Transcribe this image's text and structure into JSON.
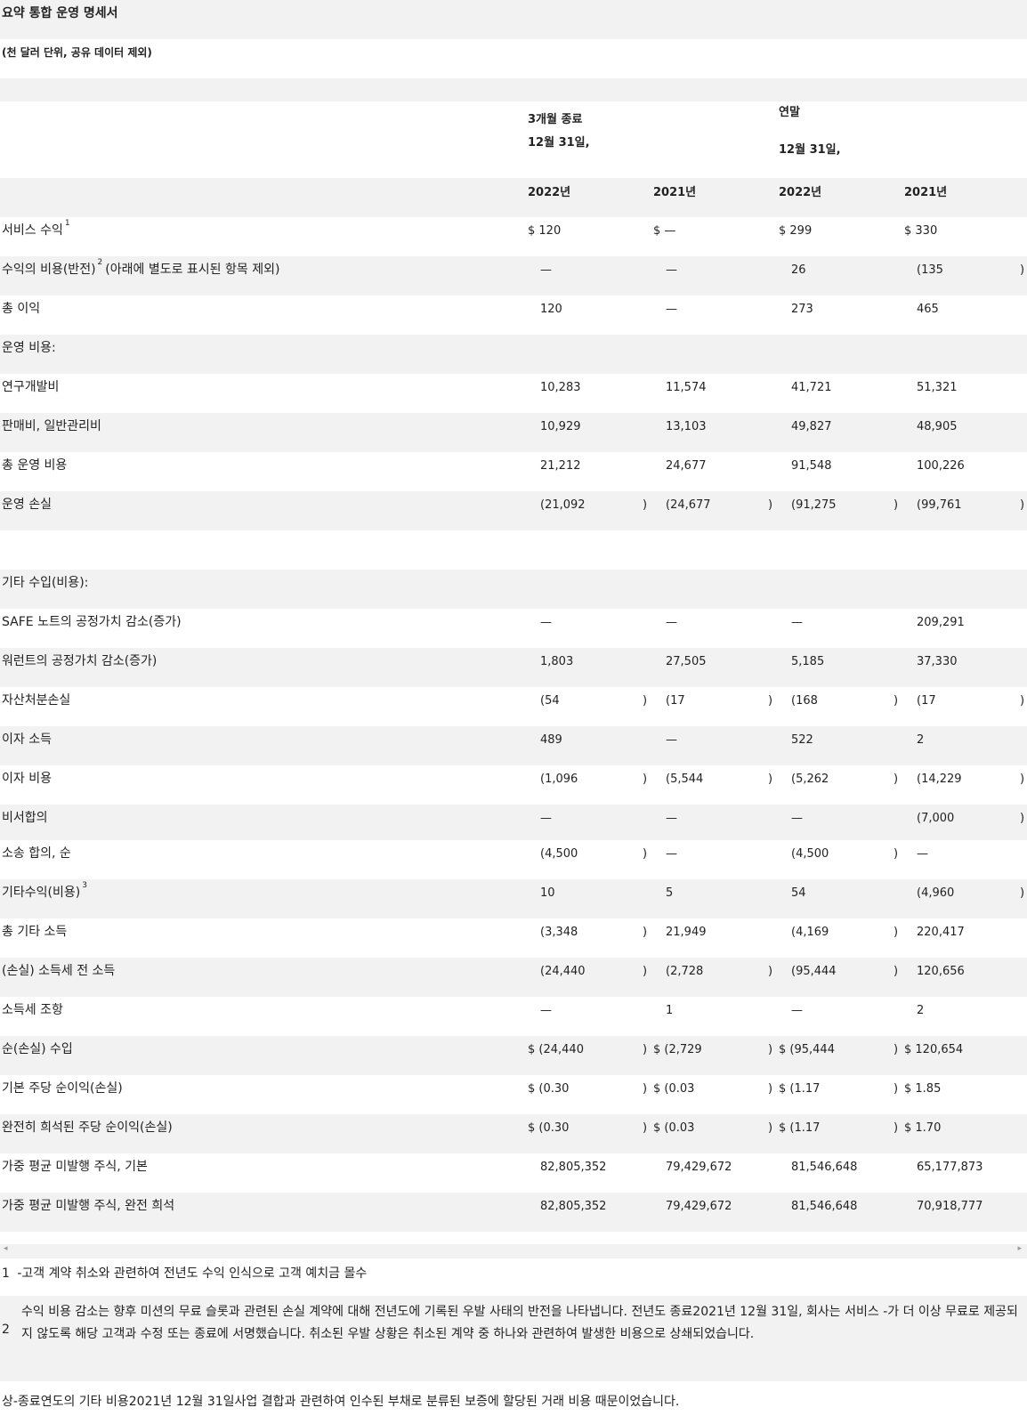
{
  "title": "요약 통합 운영 명세서",
  "subtitle": "(천 달러 단위, 공유 데이터 제외)",
  "header": {
    "three_months_line1": "3개월 종료",
    "three_months_line2": "12월 31일,",
    "year_end_line1": "연말",
    "year_end_line2": "12월 31일,",
    "years": [
      "2022년",
      "2021년",
      "2022년",
      "2021년"
    ]
  },
  "rows": [
    {
      "label": "서비스 수익",
      "sup": "1",
      "values": [
        "$ 120",
        "$ —",
        "$ 299",
        "$ 330"
      ],
      "parens": [
        false,
        false,
        false,
        false
      ]
    },
    {
      "label": "수익의 비용(반전)",
      "sup": "2",
      "label_suffix": "(아래에 별도로 표시된 항목 제외)",
      "values": [
        "—",
        "—",
        "26",
        "(135"
      ],
      "parens": [
        false,
        false,
        false,
        true
      ]
    },
    {
      "label": "총 이익",
      "values": [
        "120",
        "—",
        "273",
        "465"
      ],
      "parens": [
        false,
        false,
        false,
        false
      ]
    },
    {
      "label": "운영 비용:",
      "values": [
        "",
        "",
        "",
        ""
      ],
      "parens": [
        false,
        false,
        false,
        false
      ]
    },
    {
      "label": "연구개발비",
      "values": [
        "10,283",
        "11,574",
        "41,721",
        "51,321"
      ],
      "parens": [
        false,
        false,
        false,
        false
      ]
    },
    {
      "label": "판매비, 일반관리비",
      "values": [
        "10,929",
        "13,103",
        "49,827",
        "48,905"
      ],
      "parens": [
        false,
        false,
        false,
        false
      ]
    },
    {
      "label": "총 운영 비용",
      "values": [
        "21,212",
        "24,677",
        "91,548",
        "100,226"
      ],
      "parens": [
        false,
        false,
        false,
        false
      ]
    },
    {
      "label": "운영 손실",
      "values": [
        "(21,092",
        "(24,677",
        "(91,275",
        "(99,761"
      ],
      "parens": [
        true,
        true,
        true,
        true
      ]
    },
    {
      "label": "",
      "values": [
        "",
        "",
        "",
        ""
      ],
      "parens": [
        false,
        false,
        false,
        false
      ]
    },
    {
      "label": "기타 수입(비용):",
      "values": [
        "",
        "",
        "",
        ""
      ],
      "parens": [
        false,
        false,
        false,
        false
      ]
    },
    {
      "label": "SAFE 노트의 공정가치 감소(증가)",
      "values": [
        "—",
        "—",
        "—",
        "209,291"
      ],
      "parens": [
        false,
        false,
        false,
        false
      ]
    },
    {
      "label": "워런트의 공정가치 감소(증가)",
      "values": [
        "1,803",
        "27,505",
        "5,185",
        "37,330"
      ],
      "parens": [
        false,
        false,
        false,
        false
      ]
    },
    {
      "label": "자산처분손실",
      "values": [
        "(54",
        "(17",
        "(168",
        "(17"
      ],
      "parens": [
        true,
        true,
        true,
        true
      ]
    },
    {
      "label": "이자 소득",
      "values": [
        "489",
        "—",
        "522",
        "2"
      ],
      "parens": [
        false,
        false,
        false,
        false
      ]
    },
    {
      "label": "이자 비용",
      "values": [
        "(1,096",
        "(5,544",
        "(5,262",
        "(14,229"
      ],
      "parens": [
        true,
        true,
        true,
        true
      ]
    },
    {
      "label": "비서합의",
      "values": [
        "—",
        "—",
        "—",
        "(7,000"
      ],
      "parens": [
        false,
        false,
        false,
        true
      ],
      "short": true
    },
    {
      "label": "소송 합의, 순",
      "values": [
        "(4,500",
        "—",
        "(4,500",
        "—"
      ],
      "parens": [
        true,
        false,
        true,
        false
      ]
    },
    {
      "label": "기타수익(비용)",
      "sup": "3",
      "values": [
        "10",
        "5",
        "54",
        "(4,960"
      ],
      "parens": [
        false,
        false,
        false,
        true
      ]
    },
    {
      "label": "총 기타 소득",
      "values": [
        "(3,348",
        "21,949",
        "(4,169",
        "220,417"
      ],
      "parens": [
        true,
        false,
        true,
        false
      ]
    },
    {
      "label": "(손실) 소득세 전 소득",
      "values": [
        "(24,440",
        "(2,728",
        "(95,444",
        "120,656"
      ],
      "parens": [
        true,
        true,
        true,
        false
      ]
    },
    {
      "label": "소득세 조항",
      "values": [
        "—",
        "1",
        "—",
        "2"
      ],
      "parens": [
        false,
        false,
        false,
        false
      ]
    },
    {
      "label": "순(손실) 수입",
      "values": [
        "$ (24,440",
        "$ (2,729",
        "$ (95,444",
        "$ 120,654"
      ],
      "parens": [
        true,
        true,
        true,
        false
      ],
      "dollar": true
    },
    {
      "label": "기본 주당 순이익(손실)",
      "values": [
        "$ (0.30",
        "$ (0.03",
        "$ (1.17",
        "$ 1.85"
      ],
      "parens": [
        true,
        true,
        true,
        false
      ],
      "dollar": true
    },
    {
      "label": "완전히 희석된 주당 순이익(손실)",
      "values": [
        "$ (0.30",
        "$ (0.03",
        "$ (1.17",
        "$ 1.70"
      ],
      "parens": [
        true,
        true,
        true,
        false
      ],
      "dollar": true
    },
    {
      "label": "가중 평균 미발행 주식, 기본",
      "values": [
        "82,805,352",
        "79,429,672",
        "81,546,648",
        "65,177,873"
      ],
      "parens": [
        false,
        false,
        false,
        false
      ]
    },
    {
      "label": "가중 평균 미발행 주식, 완전 희석",
      "values": [
        "82,805,352",
        "79,429,672",
        "81,546,648",
        "70,918,777"
      ],
      "parens": [
        false,
        false,
        false,
        false
      ]
    }
  ],
  "scroll": {
    "left_arrow": "◂",
    "right_arrow": "▸"
  },
  "footnotes": {
    "fn1_num": "1",
    "fn1_text": "-고객 계약 취소와 관련하여 전년도 수익 인식으로 고객 예치금 몰수",
    "fn2_num": "2",
    "fn2_text": "수익 비용 감소는 향후 미션의 무료 슬롯과 관련된 손실 계약에 대해 전년도에 기록된 우발 사태의 반전을 나타냅니다. 전년도 종료2021년 12월 31일, 회사는 서비스 -가 더 이상 무료로 제공되지 않도록 해당 고객과 수정 또는 종료에 서명했습니다. 취소된 우발 상황은 취소된 계약 중 하나와 관련하여 발생한 비용으로 상쇄되었습니다.",
    "fn3_text": "상-종료연도의 기타 비용2021년 12월 31일사업 결합과 관련하여 인수된 부채로 분류된 보증에 할당된 거래 비용 때문이었습니다."
  }
}
